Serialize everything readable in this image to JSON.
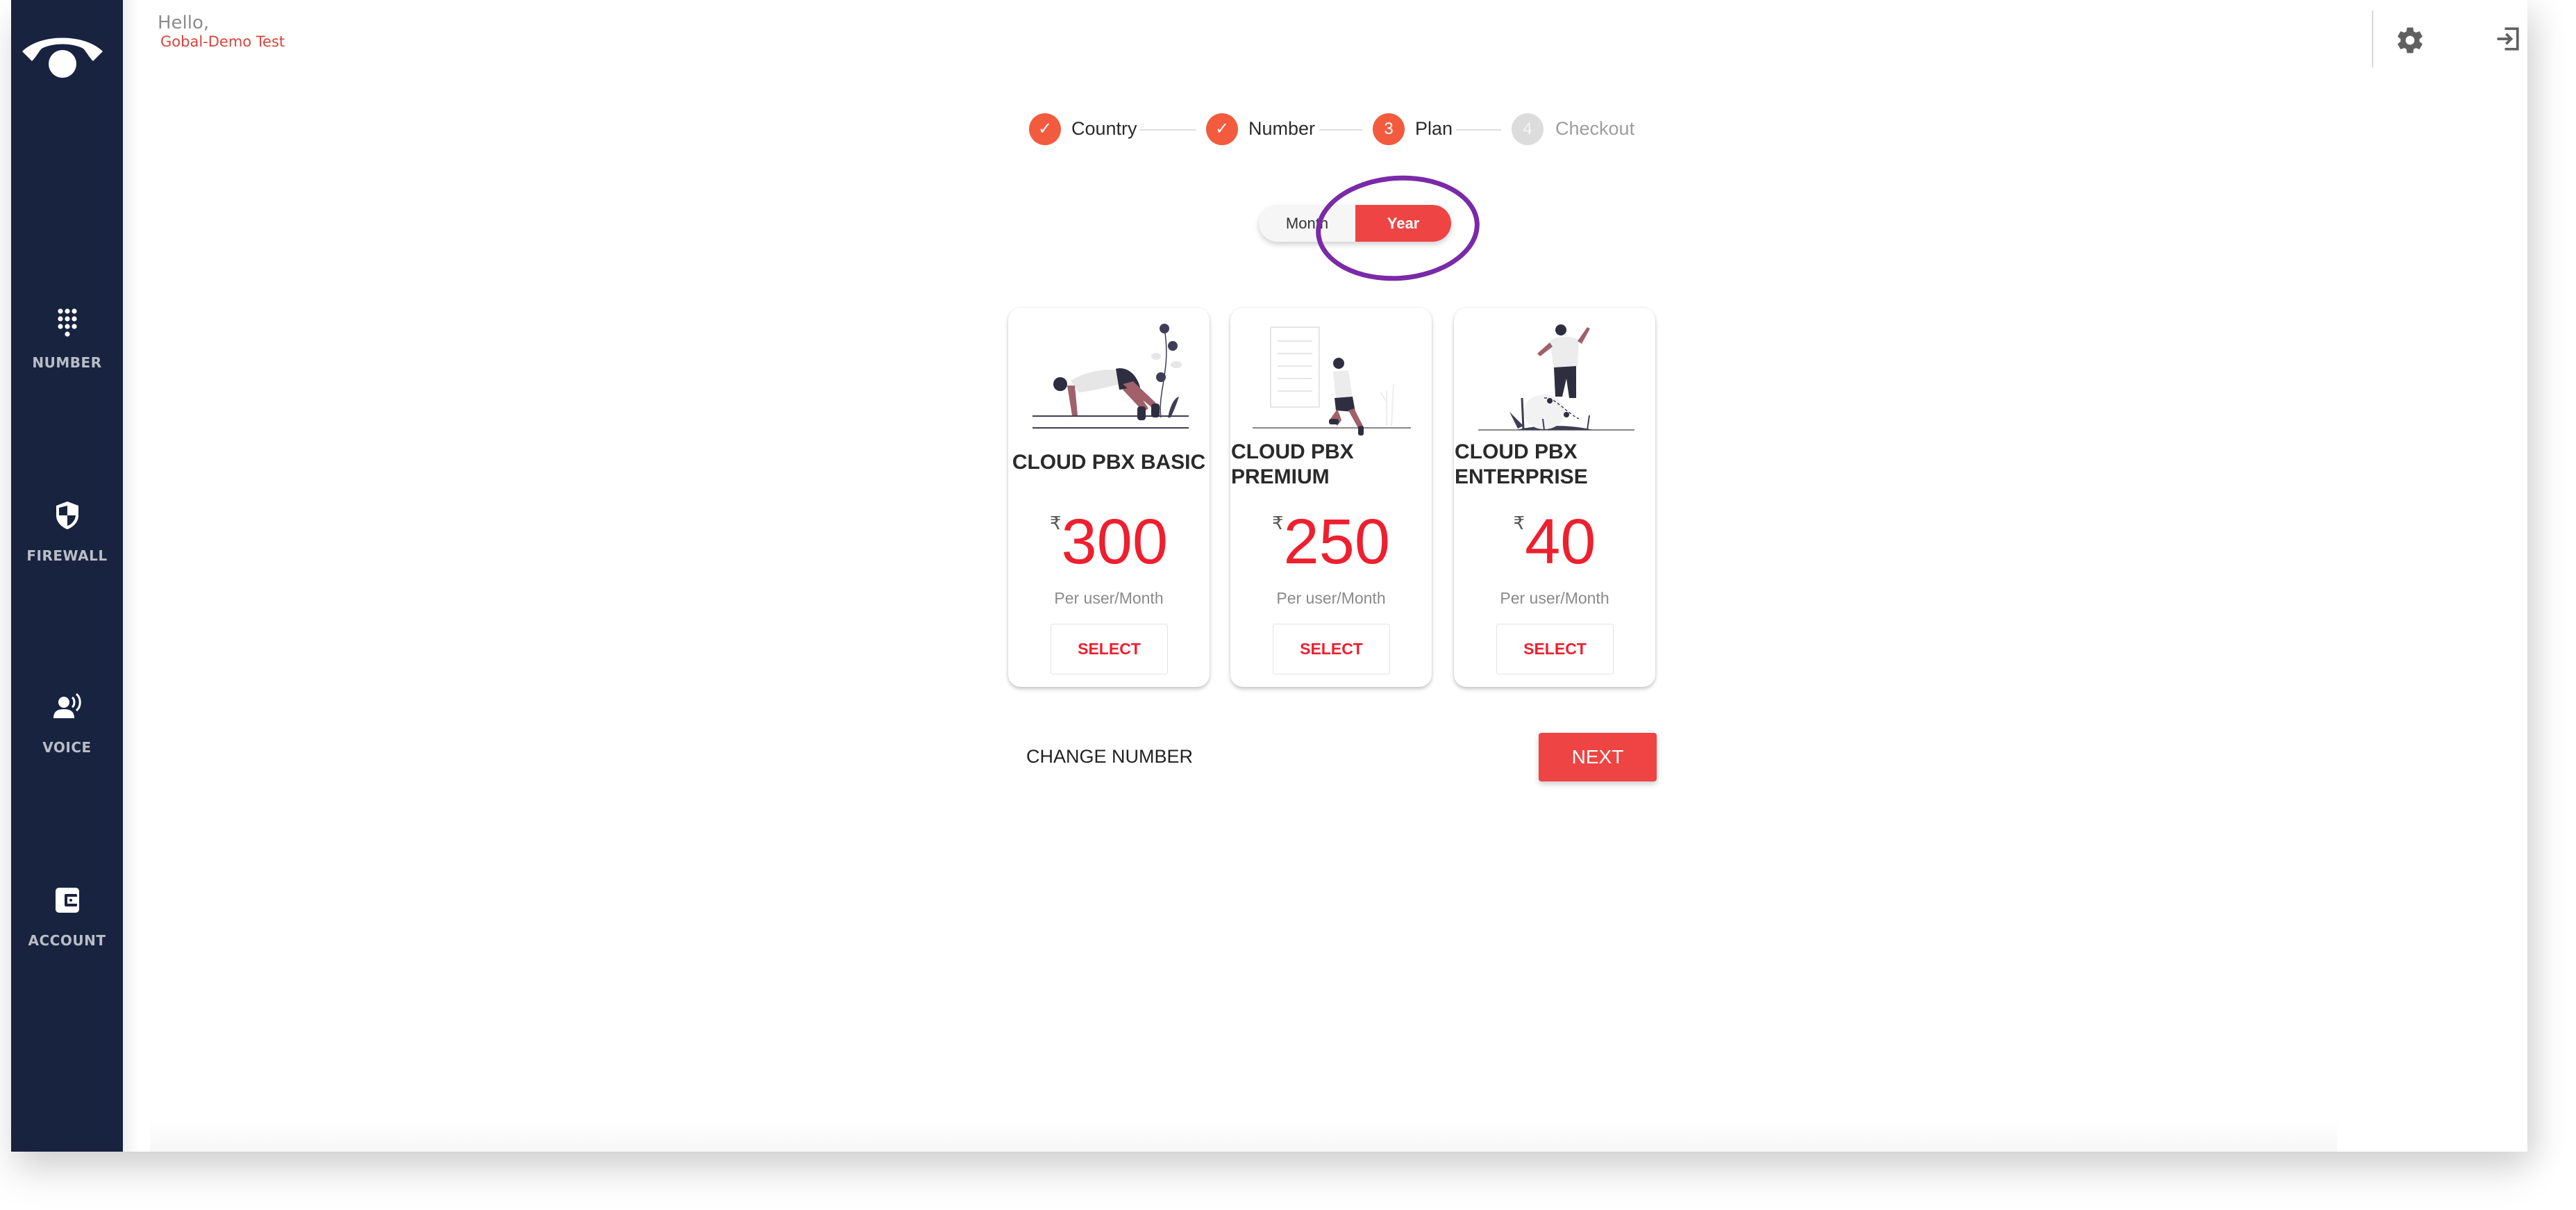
{
  "header": {
    "greeting": "Hello,",
    "user_name": "Gobal-Demo Test",
    "icons": [
      "settings-icon",
      "logout-icon"
    ]
  },
  "sidebar": {
    "logo": "phone-handset-logo",
    "items": [
      {
        "label": "NUMBER",
        "icon": "dialpad-icon"
      },
      {
        "label": "FIREWALL",
        "icon": "shield-icon"
      },
      {
        "label": "VOICE",
        "icon": "voice-user-icon"
      },
      {
        "label": "ACCOUNT",
        "icon": "wallet-icon"
      }
    ]
  },
  "stepper": {
    "steps": [
      {
        "number": "1",
        "label": "Country",
        "state": "done"
      },
      {
        "number": "2",
        "label": "Number",
        "state": "done"
      },
      {
        "number": "3",
        "label": "Plan",
        "state": "active"
      },
      {
        "number": "4",
        "label": "Checkout",
        "state": "todo"
      }
    ],
    "check_glyph": "✓"
  },
  "billing_toggle": {
    "options": [
      "Month",
      "Year"
    ],
    "selected": "Year"
  },
  "plans": [
    {
      "title": "CLOUD PBX BASIC",
      "currency": "₹",
      "price": "300",
      "period": "Per user/Month",
      "button": "SELECT"
    },
    {
      "title": "CLOUD PBX PREMIUM",
      "currency": "₹",
      "price": "250",
      "period": "Per user/Month",
      "button": "SELECT"
    },
    {
      "title": "CLOUD PBX ENTERPRISE",
      "currency": "₹",
      "price": "40",
      "period": "Per user/Month",
      "button": "SELECT"
    }
  ],
  "actions": {
    "back_label": "CHANGE NUMBER",
    "next_label": "NEXT"
  },
  "colors": {
    "sidebar_bg": "#17233f",
    "accent": "#ee4444",
    "step_accent": "#f25b3e",
    "price": "#ee1f2e",
    "annotation": "#7a2aa8"
  }
}
